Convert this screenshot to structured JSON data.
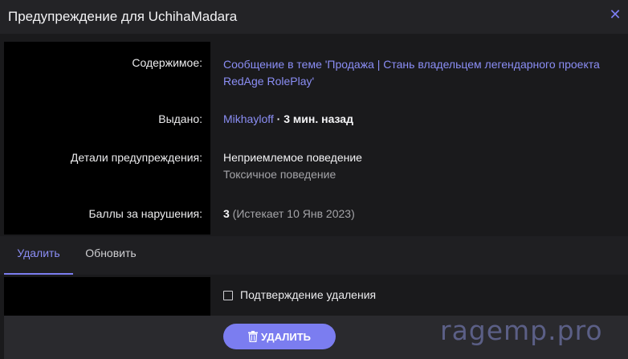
{
  "dialog": {
    "title": "Предупреждение для UchihaMadara"
  },
  "details": {
    "content_label": "Содержимое:",
    "content_value": "Сообщение в теме 'Продажа | Стань владельцем легендарного проекта RedAge RolePlay'",
    "issued_label": "Выдано:",
    "issued_by": "Mikhayloff",
    "issued_separator": " · ",
    "issued_time": "3 мин. назад",
    "details_label": "Детали предупреждения:",
    "details_title": "Неприемлемое поведение",
    "details_subtitle": "Токсичное поведение",
    "points_label": "Баллы за нарушения:",
    "points_value": "3",
    "points_expiry": " (Истекает 10 Янв 2023)"
  },
  "tabs": [
    {
      "label": "Удалить",
      "active": true
    },
    {
      "label": "Обновить",
      "active": false
    }
  ],
  "confirm": {
    "label": "Подтверждение удаления",
    "checked": false
  },
  "actions": {
    "delete_label": "УДАЛИТЬ"
  },
  "watermark": "ragemp.pro",
  "colors": {
    "accent": "#7b7df0",
    "link": "#8b8ef5",
    "background": "#1a1a1c"
  }
}
